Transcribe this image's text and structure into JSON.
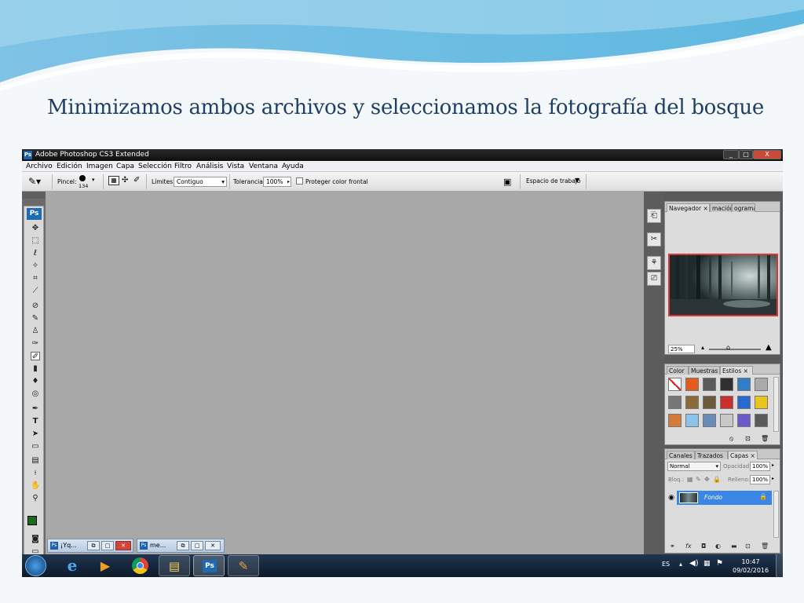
{
  "slide": {
    "title": "Minimizamos ambos archivos y seleccionamos la fotografía del bosque"
  },
  "window": {
    "logo": "Ps",
    "title": "Adobe Photoshop CS3 Extended",
    "controls": [
      "_",
      "□",
      "X"
    ]
  },
  "menu": [
    "Archivo",
    "Edición",
    "Imagen",
    "Capa",
    "Selección",
    "Filtro",
    "Análisis",
    "Vista",
    "Ventana",
    "Ayuda"
  ],
  "options_bar": {
    "brush_label": "Pincel:",
    "brush_size": "134",
    "limits_label": "Límites:",
    "limits_value": "Contiguo",
    "tolerance_label": "Tolerancia:",
    "tolerance_value": "100%",
    "protect_label": "Proteger color frontal",
    "workspace_label": "Espacio de trabajo"
  },
  "toolbox": {
    "logo": "Ps",
    "tools": [
      "move-icon",
      "marquee-icon",
      "lasso-icon",
      "magic-wand-icon",
      "crop-icon",
      "slice-icon",
      "healing-icon",
      "brush-icon",
      "stamp-icon",
      "history-brush-icon",
      "background-eraser-icon",
      "gradient-icon",
      "blur-icon",
      "dodge-icon",
      "pen-icon",
      "type-icon",
      "path-select-icon",
      "shape-icon",
      "notes-icon",
      "eyedropper-icon",
      "hand-icon",
      "zoom-icon"
    ],
    "foreground_color": "#1c6b1c",
    "background_color": "#000000"
  },
  "navigator_panel": {
    "tabs": [
      "Navegador",
      "mación",
      "ograma"
    ],
    "zoom": "25%"
  },
  "styles_panel": {
    "tabs": [
      "Color",
      "Muestras",
      "Estilos"
    ],
    "swatches": [
      "#ffffff",
      "#e35b1d",
      "#5a5a5a",
      "#303030",
      "#2f7fc7",
      "#aaaaaa",
      "#777777",
      "#8a6a3a",
      "#6e5a3a",
      "#c83030",
      "#2a6ad0",
      "#e8c51e",
      "#d47a3a",
      "#8dc3ea",
      "#6a8ab8",
      "#c8c8c8",
      "#6b5ac9",
      "#5a5a5a"
    ]
  },
  "layers_panel": {
    "tabs": [
      "Canales",
      "Trazados",
      "Capas"
    ],
    "blend_mode": "Normal",
    "opacity_label": "Opacidad:",
    "opacity_value": "100%",
    "lock_label": "Bloq.:",
    "fill_label": "Relleno:",
    "fill_value": "100%",
    "layer_name": "Fondo"
  },
  "minimized_docs": [
    {
      "label": "¡Yq..."
    },
    {
      "label": "me..."
    }
  ],
  "taskbar": {
    "language": "ES",
    "time": "10:47",
    "date": "09/02/2016"
  }
}
